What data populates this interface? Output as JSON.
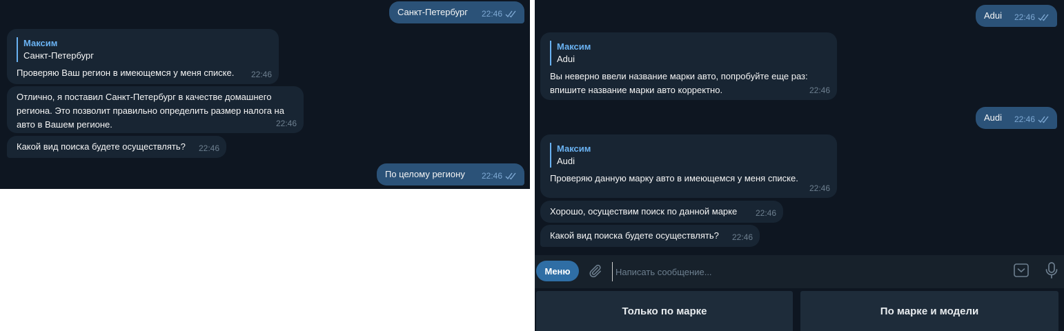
{
  "left_chat": {
    "messages": [
      {
        "dir": "out",
        "text": "Санкт-Петербург",
        "time": "22:46"
      },
      {
        "dir": "in",
        "quote_name": "Максим",
        "quote_text": "Санкт-Петербург",
        "text": "Проверяю Ваш регион в имеющемся у меня списке.",
        "time": "22:46"
      },
      {
        "dir": "in",
        "text": "Отлично, я поставил Санкт-Петербург в качестве домашнего\nрегиона. Это позволит правильно определить размер налога на\nавто в Вашем регионе.",
        "time": "22:46"
      },
      {
        "dir": "in",
        "text": "Какой вид поиска будете осуществлять?",
        "time": "22:46"
      },
      {
        "dir": "out",
        "text": "По целому региону",
        "time": "22:46"
      }
    ]
  },
  "right_chat": {
    "messages": [
      {
        "dir": "out",
        "text": "Adui",
        "time": "22:46"
      },
      {
        "dir": "in",
        "quote_name": "Максим",
        "quote_text": "Adui",
        "text": "Вы неверно ввели название марки авто, попробуйте еще раз:\nвпишите название марки авто корректно.",
        "time": "22:46"
      },
      {
        "dir": "out",
        "text": "Audi",
        "time": "22:46"
      },
      {
        "dir": "in",
        "quote_name": "Максим",
        "quote_text": "Audi",
        "text": "Проверяю данную марку авто в имеющемся у меня списке.",
        "time": "22:46"
      },
      {
        "dir": "in",
        "text": "Хорошо, осуществим поиск по данной марке",
        "time": "22:46"
      },
      {
        "dir": "in",
        "text": "Какой вид поиска будете осуществлять?",
        "time": "22:46"
      }
    ]
  },
  "composer": {
    "menu_label": "Меню",
    "placeholder": "Написать сообщение...",
    "icons": [
      "paperclip-icon",
      "keyboard-icon",
      "microphone-icon"
    ]
  },
  "keyboard": {
    "buttons": [
      "Только по марке",
      "По марке и модели"
    ]
  },
  "colors": {
    "chat_bg": "#0e1621",
    "incoming_bubble": "#182533",
    "outgoing_bubble": "#2b5278",
    "accent": "#6ab2f2",
    "menu_button": "#2f6ea5"
  }
}
